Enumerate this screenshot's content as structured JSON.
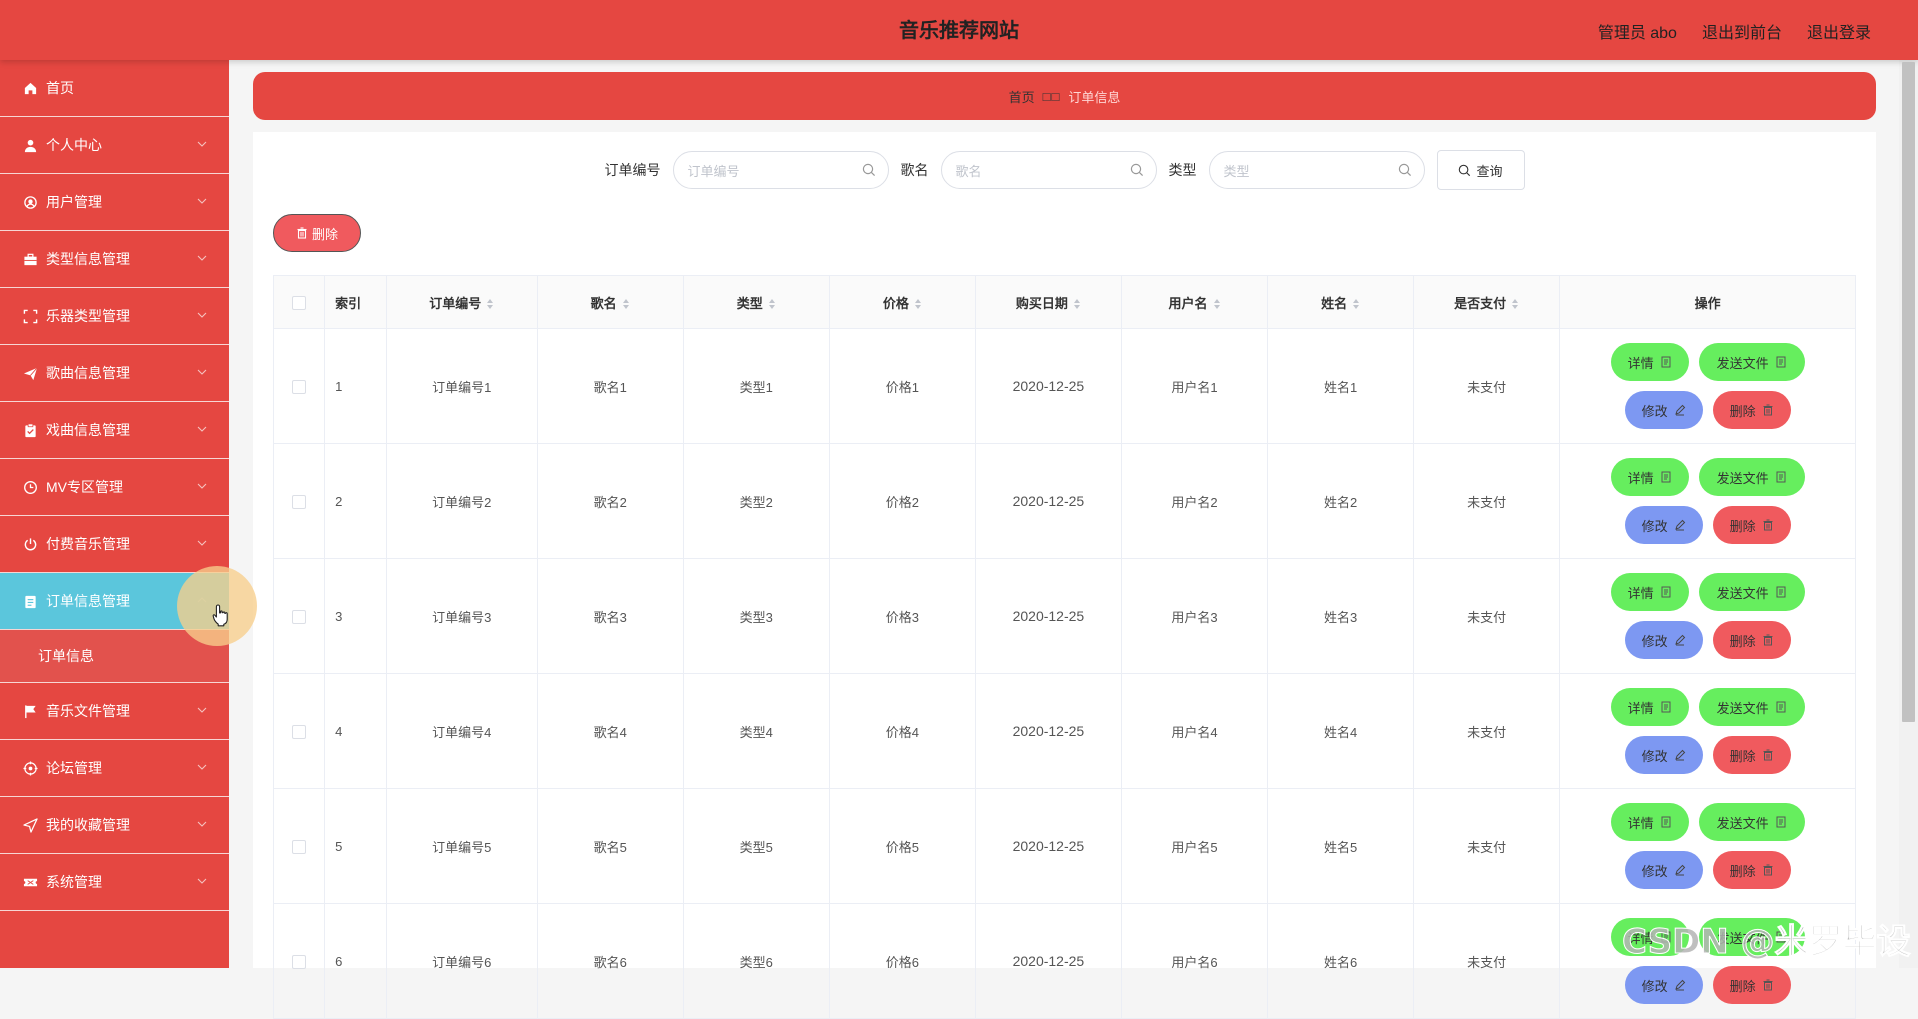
{
  "header": {
    "title": "音乐推荐网站",
    "admin_label": "管理员 abo",
    "front_link": "退出到前台",
    "logout_link": "退出登录"
  },
  "sidebar": {
    "items": [
      {
        "label": "首页",
        "icon": "home-icon"
      },
      {
        "label": "个人中心",
        "icon": "user-icon"
      },
      {
        "label": "用户管理",
        "icon": "users-icon"
      },
      {
        "label": "类型信息管理",
        "icon": "briefcase-icon"
      },
      {
        "label": "乐器类型管理",
        "icon": "frame-icon"
      },
      {
        "label": "歌曲信息管理",
        "icon": "send-icon"
      },
      {
        "label": "戏曲信息管理",
        "icon": "clipboard-icon"
      },
      {
        "label": "MV专区管理",
        "icon": "clock-icon"
      },
      {
        "label": "付费音乐管理",
        "icon": "power-icon"
      },
      {
        "label": "订单信息管理",
        "icon": "order-icon"
      },
      {
        "label": "音乐文件管理",
        "icon": "flag-icon"
      },
      {
        "label": "论坛管理",
        "icon": "target-icon"
      },
      {
        "label": "我的收藏管理",
        "icon": "navigation-icon"
      },
      {
        "label": "系统管理",
        "icon": "ticket-icon"
      }
    ],
    "active_submenu": "订单信息"
  },
  "breadcrumb": {
    "home": "首页",
    "separator": "□□",
    "current": "订单信息"
  },
  "search": {
    "order_no_label": "订单编号",
    "order_no_placeholder": "订单编号",
    "song_label": "歌名",
    "song_placeholder": "歌名",
    "type_label": "类型",
    "type_placeholder": "类型",
    "query_button": "查询"
  },
  "toolbar": {
    "delete_button": "删除"
  },
  "table": {
    "headers": [
      "索引",
      "订单编号",
      "歌名",
      "类型",
      "价格",
      "购买日期",
      "用户名",
      "姓名",
      "是否支付",
      "操作"
    ],
    "rows": [
      [
        "1",
        "订单编号1",
        "歌名1",
        "类型1",
        "价格1",
        "2020-12-25",
        "用户名1",
        "姓名1",
        "未支付"
      ],
      [
        "2",
        "订单编号2",
        "歌名2",
        "类型2",
        "价格2",
        "2020-12-25",
        "用户名2",
        "姓名2",
        "未支付"
      ],
      [
        "3",
        "订单编号3",
        "歌名3",
        "类型3",
        "价格3",
        "2020-12-25",
        "用户名3",
        "姓名3",
        "未支付"
      ],
      [
        "4",
        "订单编号4",
        "歌名4",
        "类型4",
        "价格4",
        "2020-12-25",
        "用户名4",
        "姓名4",
        "未支付"
      ],
      [
        "5",
        "订单编号5",
        "歌名5",
        "类型5",
        "价格5",
        "2020-12-25",
        "用户名5",
        "姓名5",
        "未支付"
      ],
      [
        "6",
        "订单编号6",
        "歌名6",
        "类型6",
        "价格6",
        "2020-12-25",
        "用户名6",
        "姓名6",
        "未支付"
      ]
    ],
    "actions": {
      "detail": "详情",
      "send_file": "发送文件",
      "edit": "修改",
      "delete": "删除"
    }
  },
  "watermark": "CSDN @米罗毕设",
  "colors": {
    "primary": "#e54741",
    "active_menu": "#5bc6dc",
    "success": "#66ee5e",
    "edit": "#7d98f2",
    "danger": "#f05a5e"
  }
}
